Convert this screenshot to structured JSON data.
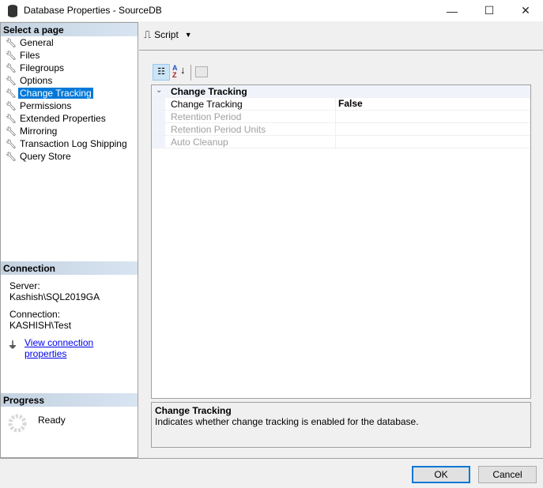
{
  "window": {
    "title": "Database Properties - SourceDB",
    "minimize": "—",
    "maximize": "☐",
    "close": "✕"
  },
  "sidebar": {
    "header": "Select a page",
    "items": [
      {
        "label": "General"
      },
      {
        "label": "Files"
      },
      {
        "label": "Filegroups"
      },
      {
        "label": "Options"
      },
      {
        "label": "Change Tracking",
        "selected": true
      },
      {
        "label": "Permissions"
      },
      {
        "label": "Extended Properties"
      },
      {
        "label": "Mirroring"
      },
      {
        "label": "Transaction Log Shipping"
      },
      {
        "label": "Query Store"
      }
    ]
  },
  "connection": {
    "header": "Connection",
    "server_label": "Server:",
    "server": "Kashish\\SQL2019GA",
    "connection_label": "Connection:",
    "connection": "KASHISH\\Test",
    "link": "View connection properties"
  },
  "progress": {
    "header": "Progress",
    "status": "Ready"
  },
  "toolbar": {
    "script_label": "Script"
  },
  "grid": {
    "category": "Change Tracking",
    "rows": [
      {
        "name": "Change Tracking",
        "value": "False",
        "enabled": true
      },
      {
        "name": "Retention Period",
        "value": "",
        "enabled": false
      },
      {
        "name": "Retention Period Units",
        "value": "",
        "enabled": false
      },
      {
        "name": "Auto Cleanup",
        "value": "",
        "enabled": false
      }
    ]
  },
  "description": {
    "title": "Change Tracking",
    "text": "Indicates whether change tracking is enabled for the database."
  },
  "buttons": {
    "ok": "OK",
    "cancel": "Cancel"
  }
}
